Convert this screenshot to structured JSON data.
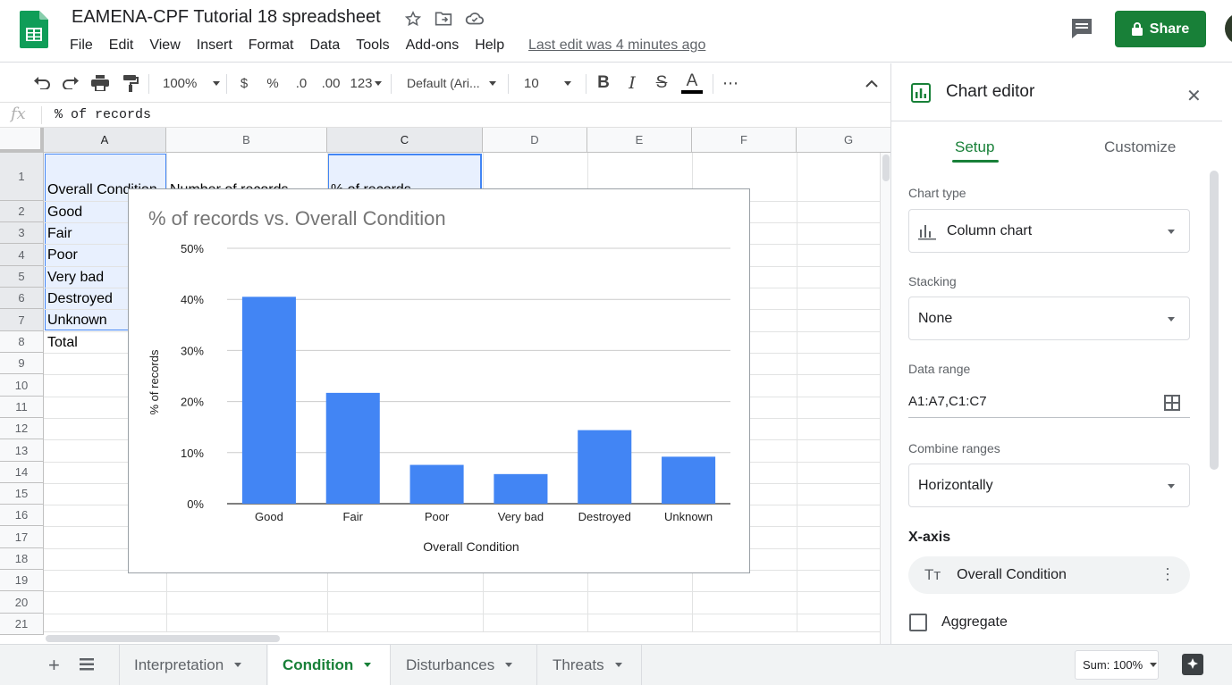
{
  "app": {
    "doc_title": "EAMENA-CPF Tutorial 18 spreadsheet",
    "menu": [
      "File",
      "Edit",
      "View",
      "Insert",
      "Format",
      "Data",
      "Tools",
      "Add-ons",
      "Help"
    ],
    "last_edit": "Last edit was 4 minutes ago",
    "share_label": "Share",
    "brand_color": "#188038",
    "icons": [
      "sheets-logo-icon",
      "star-icon",
      "move-to-folder-icon",
      "cloud-status-icon",
      "comments-icon",
      "lock-icon"
    ]
  },
  "toolbar": {
    "zoom": "100%",
    "currency": "$",
    "percent": "%",
    "decrease_decimals": ".0",
    "increase_decimals": ".00",
    "more_formats": "123",
    "font": "Default (Ari...",
    "font_size": "10",
    "bold": "B",
    "italic": "I",
    "strikethrough": "S",
    "text_color": "A",
    "more": "⋯"
  },
  "formula_bar": {
    "fx": "fx",
    "content": "% of records"
  },
  "grid": {
    "columns": [
      "A",
      "B",
      "C",
      "D",
      "E",
      "F",
      "G"
    ],
    "rows": [
      "1",
      "2",
      "3",
      "4",
      "5",
      "6",
      "7",
      "8",
      "9",
      "10",
      "11",
      "12",
      "13",
      "14",
      "15",
      "16",
      "17",
      "18",
      "19",
      "20",
      "21"
    ],
    "cells": {
      "A1": "Overall Condition",
      "B1": "Number of records",
      "C1": "% of records",
      "A2": "Good",
      "A3": "Fair",
      "A4": "Poor",
      "A5": "Very bad",
      "A6": "Destroyed",
      "A7": "Unknown",
      "A8": "Total"
    }
  },
  "chart_data": {
    "type": "bar",
    "title": "% of records vs. Overall Condition",
    "xlabel": "Overall Condition",
    "ylabel": "% of records",
    "categories": [
      "Good",
      "Fair",
      "Poor",
      "Very bad",
      "Destroyed",
      "Unknown"
    ],
    "values": [
      40.5,
      21.7,
      7.6,
      5.8,
      14.4,
      9.2
    ],
    "ylim": [
      0,
      50
    ],
    "yticks": [
      "0%",
      "10%",
      "20%",
      "30%",
      "40%",
      "50%"
    ],
    "grid": true,
    "legend": "none",
    "bar_color": "#4285f4"
  },
  "sheets": {
    "tabs": [
      "Interpretation",
      "Condition",
      "Disturbances",
      "Threats"
    ],
    "active": "Condition",
    "sum": "Sum: 100%"
  },
  "editor": {
    "title": "Chart editor",
    "tabs": [
      "Setup",
      "Customize"
    ],
    "chart_type_label": "Chart type",
    "chart_type": "Column chart",
    "stacking_label": "Stacking",
    "stacking": "None",
    "data_range_label": "Data range",
    "data_range": "A1:A7,C1:C7",
    "combine_label": "Combine ranges",
    "combine": "Horizontally",
    "xaxis_heading": "X-axis",
    "xaxis_value": "Overall Condition",
    "aggregate_label": "Aggregate",
    "aggregate_checked": false
  }
}
